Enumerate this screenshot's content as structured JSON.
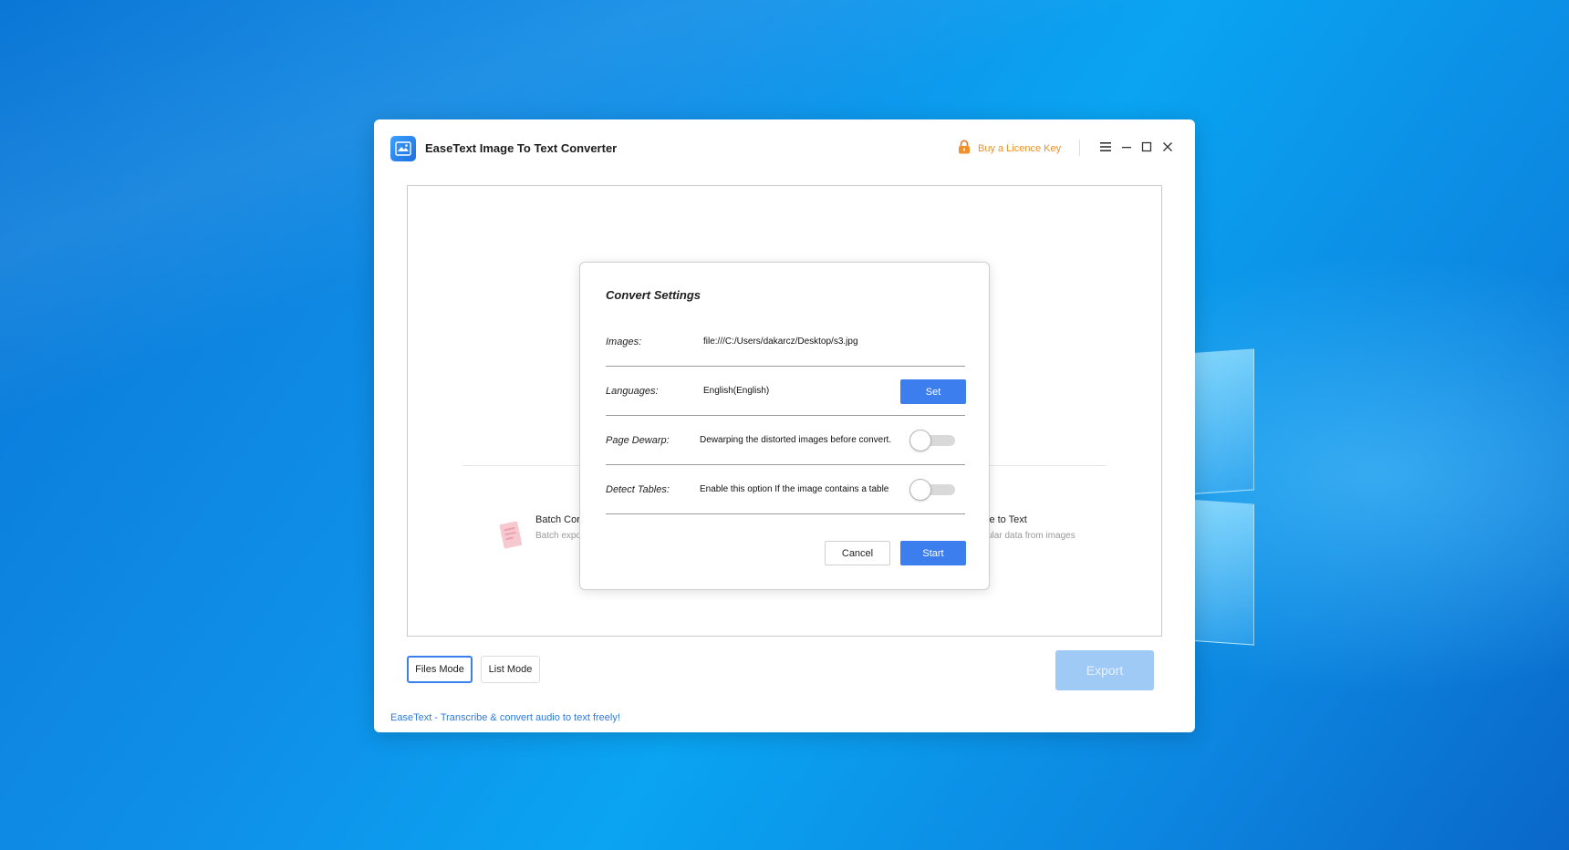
{
  "colors": {
    "accent": "#3c7eee",
    "licence": "#f0902a",
    "link": "#2d7ae0",
    "export_disabled": "#9fcaf5"
  },
  "app": {
    "title": "EaseText Image To Text Converter",
    "logo_icon": "app-logo-icon"
  },
  "titlebar": {
    "licence_label": "Buy a Licence Key",
    "licence_icon": "lock-icon",
    "menu_icon": "hamburger-menu-icon",
    "minimize_icon": "minimize-icon",
    "maximize_icon": "maximize-icon",
    "close_icon": "close-icon"
  },
  "features": {
    "left_title": "Batch Cor",
    "left_desc": "Batch expo",
    "right_title": "le to Text",
    "right_desc": "ular data from images"
  },
  "modes": {
    "files": "Files Mode",
    "list": "List Mode"
  },
  "export_label": "Export",
  "footer": {
    "link": "EaseText - Transcribe & convert audio to text freely!"
  },
  "dialog": {
    "title": "Convert Settings",
    "rows": [
      {
        "label": "Images:",
        "value": "file:///C:/Users/dakarcz/Desktop/s3.jpg"
      },
      {
        "label": "Languages:",
        "value": "English(English)",
        "button": "Set"
      },
      {
        "label": "Page Dewarp:",
        "value": "Dewarping the distorted images before convert.",
        "toggle": false
      },
      {
        "label": "Detect Tables:",
        "value": "Enable this option If the image contains a table",
        "toggle": false
      }
    ],
    "cancel": "Cancel",
    "start": "Start"
  }
}
